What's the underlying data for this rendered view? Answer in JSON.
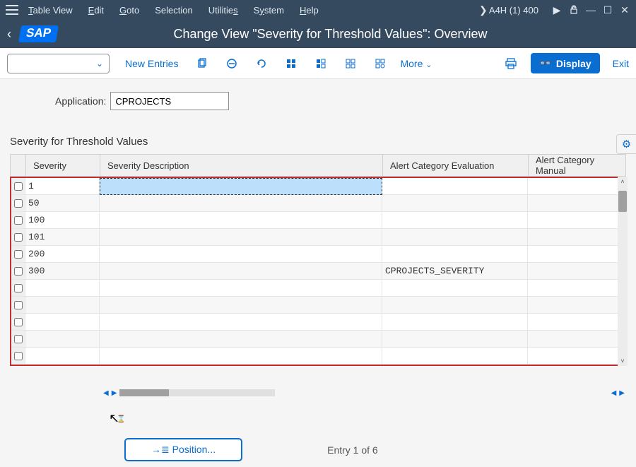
{
  "menu": {
    "table_view": "Table View",
    "edit": "Edit",
    "goto": "Goto",
    "selection": "Selection",
    "utilities": "Utilities",
    "system": "System",
    "help": "Help",
    "system_id": "A4H (1) 400"
  },
  "title": "Change View \"Severity for Threshold Values\": Overview",
  "toolbar": {
    "new_entries": "New Entries",
    "more": "More",
    "display": "Display",
    "exit": "Exit"
  },
  "field": {
    "application_label": "Application:",
    "application_value": "CPROJECTS"
  },
  "section_title": "Severity for Threshold Values",
  "columns": {
    "severity": "Severity",
    "description": "Severity Description",
    "evaluation": "Alert Category Evaluation",
    "manual": "Alert Category Manual"
  },
  "rows": [
    {
      "sev": "1",
      "desc": "",
      "eval": "",
      "man": ""
    },
    {
      "sev": "50",
      "desc": "",
      "eval": "",
      "man": ""
    },
    {
      "sev": "100",
      "desc": "",
      "eval": "",
      "man": ""
    },
    {
      "sev": "101",
      "desc": "",
      "eval": "",
      "man": ""
    },
    {
      "sev": "200",
      "desc": "",
      "eval": "",
      "man": ""
    },
    {
      "sev": "300",
      "desc": "",
      "eval": "CPROJECTS_SEVERITY",
      "man": ""
    }
  ],
  "footer": {
    "position": "→≣ Position...",
    "entry": "Entry 1 of 6"
  }
}
